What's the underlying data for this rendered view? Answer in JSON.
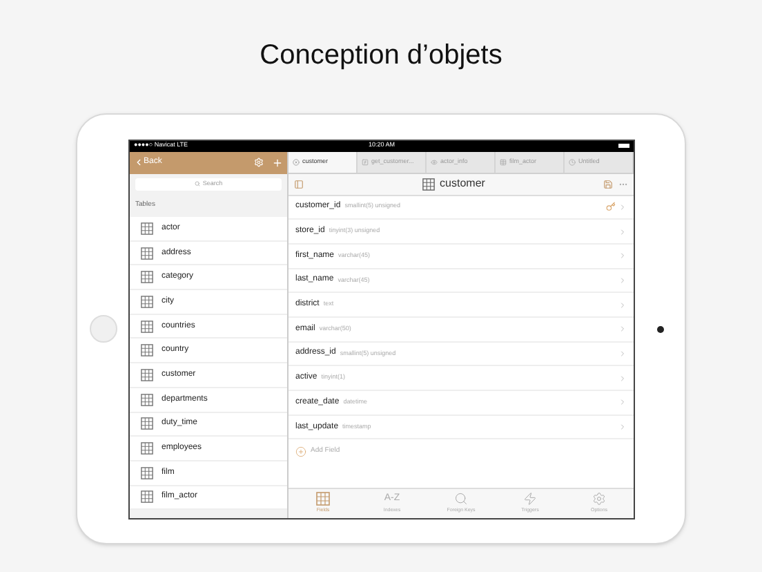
{
  "headline": "Conception d’objets",
  "status_bar": {
    "carrier": "●●●●○ Navicat LTE",
    "time": "10:20 AM"
  },
  "sidebar": {
    "back": "Back",
    "search": {
      "placeholder": "Search"
    },
    "section": "Tables",
    "items": [
      {
        "label": "actor"
      },
      {
        "label": "address"
      },
      {
        "label": "category"
      },
      {
        "label": "city"
      },
      {
        "label": "countries"
      },
      {
        "label": "country"
      },
      {
        "label": "customer"
      },
      {
        "label": "departments"
      },
      {
        "label": "duty_time"
      },
      {
        "label": "employees"
      },
      {
        "label": "film"
      },
      {
        "label": "film_actor"
      }
    ]
  },
  "tabs": [
    {
      "kind": "close",
      "label": "customer",
      "selected": true
    },
    {
      "kind": "function",
      "label": "get_customer...",
      "selected": false
    },
    {
      "kind": "view",
      "label": "actor_info",
      "selected": false
    },
    {
      "kind": "table",
      "label": "film_actor",
      "selected": false
    },
    {
      "kind": "query",
      "label": "Untitled",
      "selected": false
    }
  ],
  "title": "customer",
  "fields": [
    {
      "name": "customer_id",
      "type": "smallint(5) unsigned",
      "primary_key": true
    },
    {
      "name": "store_id",
      "type": "tinyint(3) unsigned",
      "primary_key": false
    },
    {
      "name": "first_name",
      "type": "varchar(45)",
      "primary_key": false
    },
    {
      "name": "last_name",
      "type": "varchar(45)",
      "primary_key": false
    },
    {
      "name": "district",
      "type": "text",
      "primary_key": false
    },
    {
      "name": "email",
      "type": "varchar(50)",
      "primary_key": false
    },
    {
      "name": "address_id",
      "type": "smallint(5) unsigned",
      "primary_key": false
    },
    {
      "name": "active",
      "type": "tinyint(1)",
      "primary_key": false
    },
    {
      "name": "create_date",
      "type": "datetime",
      "primary_key": false
    },
    {
      "name": "last_update",
      "type": "timestamp",
      "primary_key": false
    }
  ],
  "add_field": "Add Field",
  "bottom_tabs": [
    {
      "kind": "fields",
      "label": "Fields",
      "selected": true
    },
    {
      "kind": "indexes",
      "icon_text": "A-Z",
      "label": "Indexes",
      "selected": false
    },
    {
      "kind": "keys",
      "label": "Foreign Keys",
      "selected": false
    },
    {
      "kind": "triggers",
      "label": "Triggers",
      "selected": false
    },
    {
      "kind": "options",
      "label": "Options",
      "selected": false
    }
  ]
}
